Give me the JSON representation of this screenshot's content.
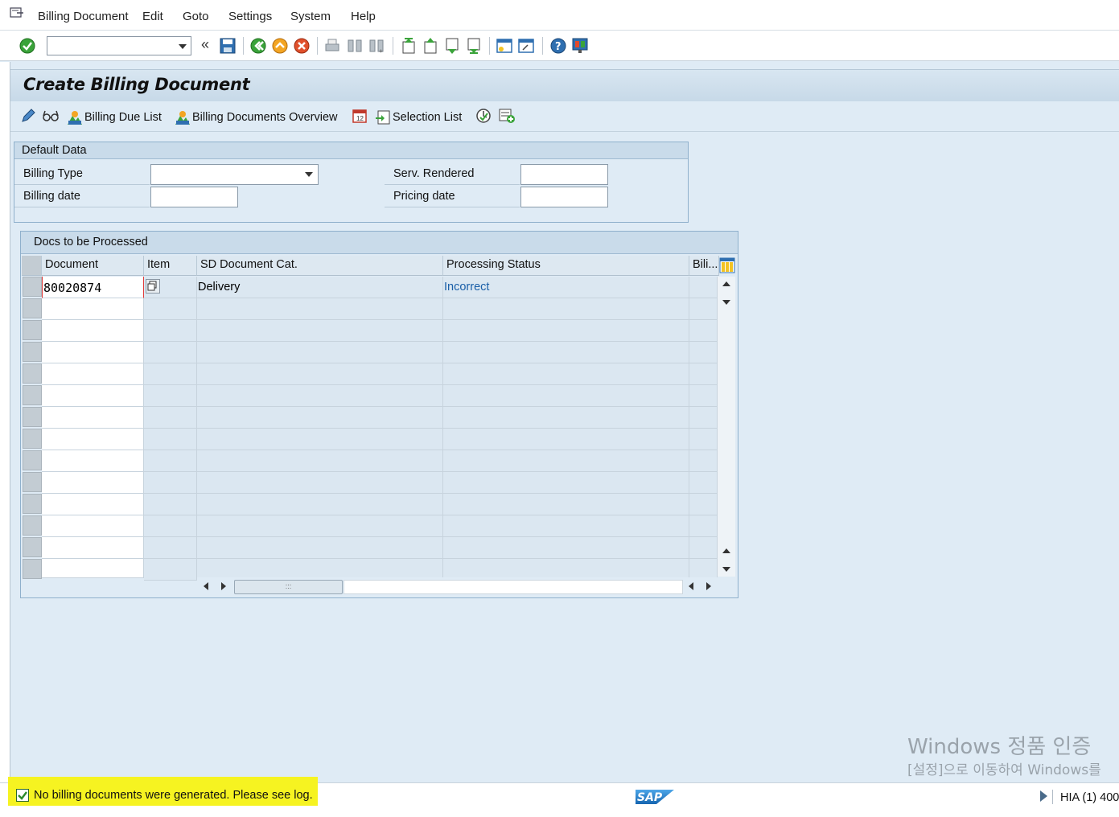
{
  "menubar": {
    "items": [
      {
        "label": "Billing Document"
      },
      {
        "label": "Edit"
      },
      {
        "label": "Goto"
      },
      {
        "label": "Settings"
      },
      {
        "label": "System"
      },
      {
        "label": "Help"
      }
    ]
  },
  "toolbar": {
    "command_value": "",
    "icons": [
      "enter-icon",
      "back-icon",
      "save-icon",
      "back-green-icon",
      "exit-icon",
      "cancel-icon",
      "print-icon",
      "find-icon",
      "find-next-icon",
      "first-page-icon",
      "previous-page-icon",
      "next-page-icon",
      "last-page-icon",
      "create-session-icon",
      "shortcut-icon",
      "help-icon",
      "customize-layout-icon"
    ]
  },
  "title": "Create Billing Document",
  "app_toolbar": {
    "billing_due_list": "Billing Due List",
    "billing_docs_overview": "Billing Documents Overview",
    "selection_list": "Selection List"
  },
  "default_data": {
    "header": "Default Data",
    "billing_type_label": "Billing Type",
    "billing_type_value": "",
    "billing_date_label": "Billing date",
    "billing_date_value": "",
    "serv_rendered_label": "Serv. Rendered",
    "serv_rendered_value": "",
    "pricing_date_label": "Pricing date",
    "pricing_date_value": ""
  },
  "docs_table": {
    "header": "Docs to be Processed",
    "columns": [
      "Document",
      "Item",
      "SD Document Cat.",
      "Processing Status",
      "Bili..."
    ],
    "rows": [
      {
        "document": "80020874",
        "item": "",
        "sd_cat": "Delivery",
        "status": "Incorrect",
        "bili": ""
      }
    ]
  },
  "status": {
    "message": "No billing documents were generated. Please see log.",
    "system_info": "HIA (1) 400",
    "accent": "#f6f321"
  },
  "watermark": {
    "line1": "Windows 정품 인증",
    "line2": "[설정]으로 이동하여 Windows를"
  }
}
